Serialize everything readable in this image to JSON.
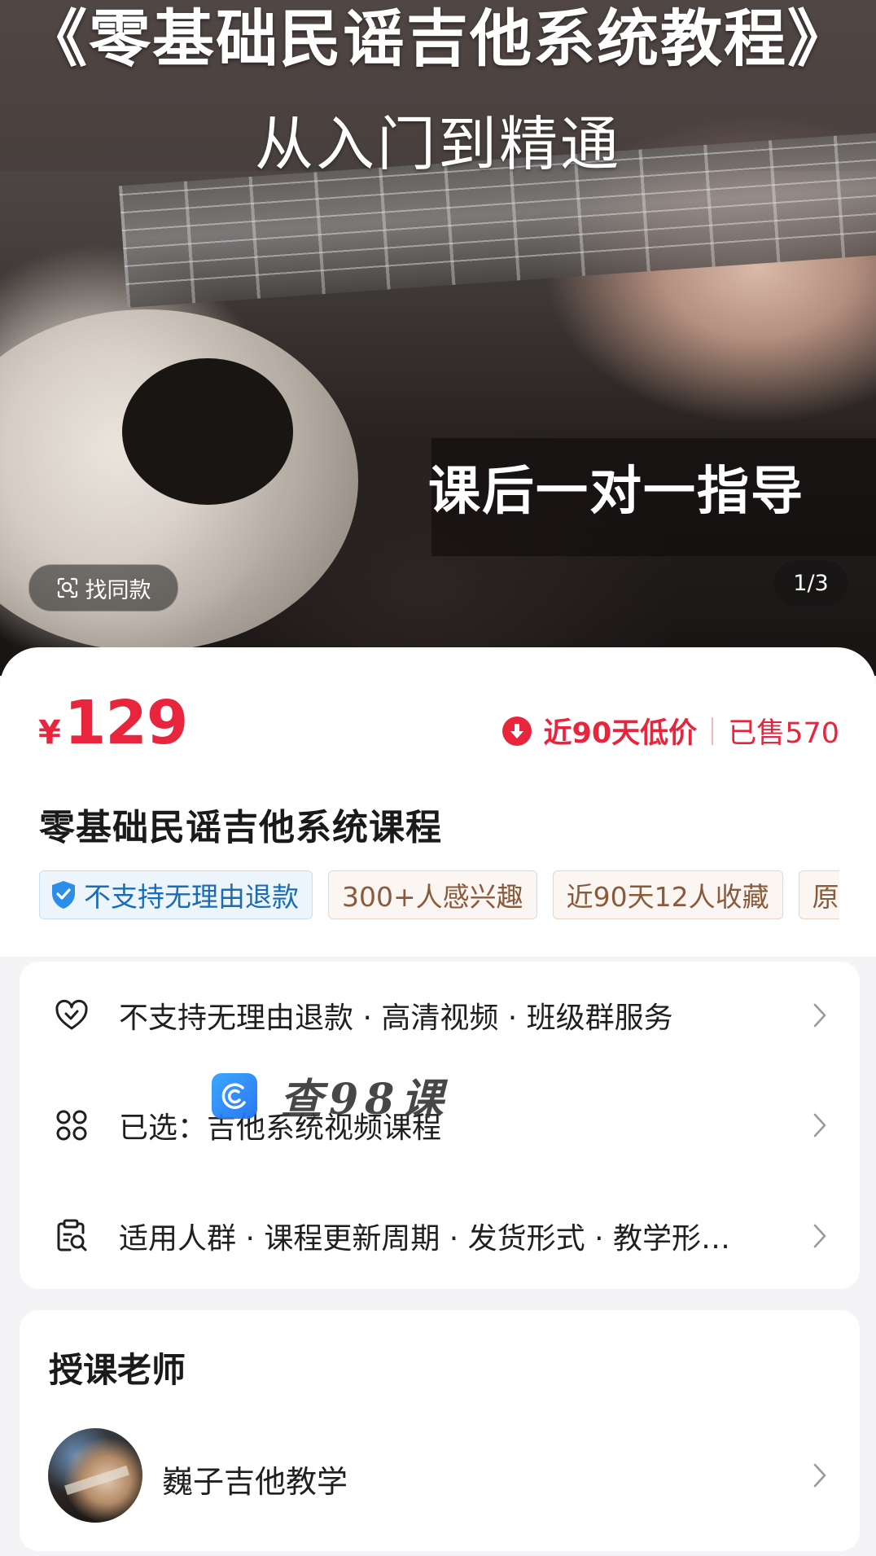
{
  "hero": {
    "title": "《零基础民谣吉他系统教程》",
    "subtitle": "从入门到精通",
    "caption": "课后一对一指导",
    "find_same_label": "找同款",
    "pager": "1/3"
  },
  "product": {
    "currency": "¥",
    "price": "129",
    "low_price_label": "近90天低价",
    "sold_label": "已售570",
    "title": "零基础民谣吉他系统课程",
    "tags": [
      "不支持无理由退款",
      "300+人感兴趣",
      "近90天12人收藏",
      "原"
    ]
  },
  "services": {
    "row1": "不支持无理由退款 · 高清视频 · 班级群服务",
    "row2": "已选：吉他系统视频课程",
    "row3": "适用人群 · 课程更新周期 · 发货形式 · 教学形…"
  },
  "watermark": {
    "text": "查98课"
  },
  "teacher": {
    "heading": "授课老师",
    "name": "巍子吉他教学"
  },
  "colors": {
    "price_red": "#e8253d",
    "tag_brown": "#8a5a3c",
    "tag_blue": "#1b6cb3"
  },
  "icons": {
    "find_same": "scan-search-icon",
    "low_price": "down-arrow-circle-icon",
    "guarantee": "shield-check-icon",
    "service": "heart-shield-icon",
    "selected": "grid-4-icon",
    "params": "clipboard-search-icon",
    "chevron": "chevron-right-icon"
  }
}
